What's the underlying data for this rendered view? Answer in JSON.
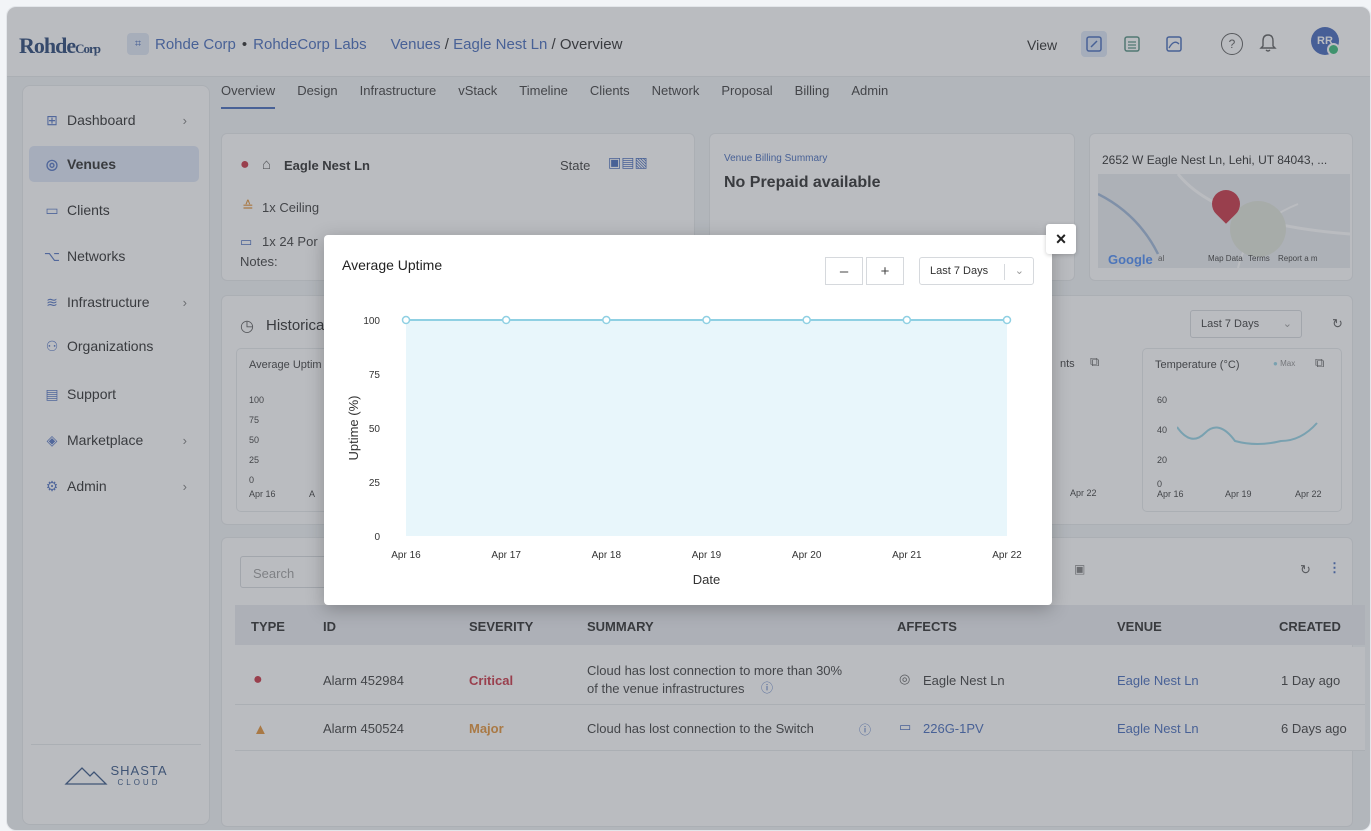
{
  "brand": {
    "logo_main": "Rohde",
    "logo_sub": "Corp"
  },
  "breadcrumb": {
    "org": "Rohde Corp",
    "sep": "•",
    "suborg": "RohdeCorp Labs",
    "venues": "Venues",
    "slash1": "/",
    "venue": "Eagle Nest Ln",
    "slash2": "/",
    "page": "Overview"
  },
  "header": {
    "view_label": "View",
    "avatar_initials": "RR",
    "help": "?",
    "bell": "🔔"
  },
  "sidebar": {
    "items": [
      {
        "label": "Dashboard",
        "icon": "grid-icon",
        "chevron": "›"
      },
      {
        "label": "Venues",
        "icon": "location-icon"
      },
      {
        "label": "Clients",
        "icon": "devices-icon"
      },
      {
        "label": "Networks",
        "icon": "network-icon"
      },
      {
        "label": "Infrastructure",
        "icon": "router-icon",
        "chevron": "›"
      },
      {
        "label": "Organizations",
        "icon": "users-icon"
      },
      {
        "label": "Support",
        "icon": "support-icon"
      },
      {
        "label": "Marketplace",
        "icon": "tag-icon",
        "chevron": "›"
      },
      {
        "label": "Admin",
        "icon": "gear-icon",
        "chevron": "›"
      }
    ],
    "footer_brand": "SHASTA",
    "footer_sub": "CLOUD"
  },
  "tabs": [
    "Overview",
    "Design",
    "Infrastructure",
    "vStack",
    "Timeline",
    "Clients",
    "Network",
    "Proposal",
    "Billing",
    "Admin"
  ],
  "venue_card": {
    "name": "Eagle Nest Ln",
    "state_label": "State",
    "ceiling": "1x Ceiling",
    "ports": "1x 24 Por",
    "notes_label": "Notes:"
  },
  "billing_card": {
    "title": "Venue Billing Summary",
    "value": "No Prepaid available"
  },
  "map_card": {
    "address": "2652 W Eagle Nest Ln, Lehi, UT 84043, ...",
    "google": "Google",
    "map_data": "Map Data",
    "terms": "Terms",
    "report": "Report a m",
    "natural": "al"
  },
  "historical": {
    "title": "Historica",
    "range": "Last 7 Days",
    "mini_uptime_title": "Average Uptim",
    "mini_uptime_ticks": [
      "100",
      "75",
      "50",
      "25",
      "0"
    ],
    "mini_uptime_x": [
      "Apr 16",
      "A"
    ],
    "clients_title_frag": "nts",
    "clients_x_frag": "Apr 22",
    "temperature_title": "Temperature (°C)",
    "temperature_legend": "Max",
    "temperature_ticks": [
      "60",
      "40",
      "20",
      "0"
    ],
    "temperature_x": [
      "Apr 16",
      "Apr 19",
      "Apr 22"
    ]
  },
  "alarms": {
    "search_placeholder": "Search",
    "columns": [
      "TYPE",
      "ID",
      "SEVERITY",
      "SUMMARY",
      "AFFECTS",
      "VENUE",
      "CREATED"
    ],
    "rows": [
      {
        "id": "Alarm 452984",
        "severity": "Critical",
        "summary_line1": "Cloud has lost connection to more than 30%",
        "summary_line2": "of the venue infrastructures",
        "affects": "Eagle Nest Ln",
        "venue": "Eagle Nest Ln",
        "created": "1 Day ago"
      },
      {
        "id": "Alarm 450524",
        "severity": "Major",
        "summary_line1": "Cloud has lost connection to the Switch",
        "affects": "226G-1PV",
        "venue": "Eagle Nest Ln",
        "created": "6 Days ago"
      }
    ]
  },
  "modal": {
    "title": "Average Uptime",
    "zoom_out": "–",
    "zoom_in": "+",
    "range": "Last 7 Days",
    "close": "×"
  },
  "colors": {
    "accent": "#3c63b7",
    "line": "#8fd0e3",
    "fill": "#e8f6fb",
    "critical": "#c7283a",
    "major": "#e28c2b"
  },
  "chart_data": {
    "type": "area",
    "title": "Average Uptime",
    "xlabel": "Date",
    "ylabel": "Uptime (%)",
    "x": [
      "Apr 16",
      "Apr 17",
      "Apr 18",
      "Apr 19",
      "Apr 20",
      "Apr 21",
      "Apr 22"
    ],
    "series": [
      {
        "values": [
          100,
          100,
          100,
          100,
          100,
          100,
          100
        ]
      }
    ],
    "ylim": [
      0,
      100
    ],
    "yticks": [
      0,
      25,
      50,
      75,
      100
    ],
    "grid": false
  }
}
